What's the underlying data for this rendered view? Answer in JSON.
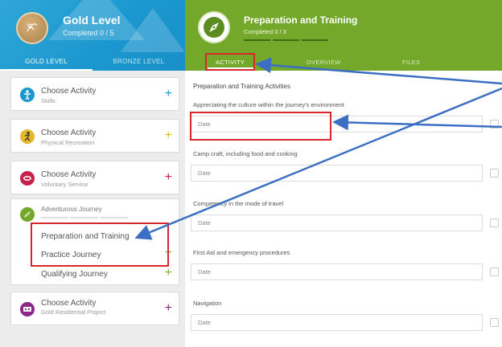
{
  "level_panel": {
    "title": "Gold Level",
    "completed": "Completed 0 / 5",
    "tabs": [
      "GOLD LEVEL",
      "BRONZE LEVEL"
    ]
  },
  "activities": [
    {
      "title": "Choose Activity",
      "subtitle": "Skills",
      "color": "#1b97cf",
      "icon": "person-icon"
    },
    {
      "title": "Choose Activity",
      "subtitle": "Physical Recreation",
      "color": "#e5b82a",
      "icon": "runner-icon"
    },
    {
      "title": "Choose Activity",
      "subtitle": "Voluntary Service",
      "color": "#c8214f",
      "icon": "lips-icon"
    },
    {
      "title": "Choose Activity",
      "subtitle": "Gold Residential Project",
      "color": "#8b2a89",
      "icon": "people-icon"
    }
  ],
  "adventurous": {
    "title": "Adventurous Journey",
    "color": "#74a82a",
    "items": [
      "Preparation and Training",
      "Practice Journey",
      "Qualifying Journey"
    ]
  },
  "detail": {
    "title": "Preparation and Training",
    "completed": "Completed 0 / 3",
    "tabs": [
      "ACTIVITY",
      "OVERVIEW",
      "FILES"
    ],
    "section_title": "Preparation and Training Activities",
    "date_placeholder": "Date",
    "fields": [
      "Appreciating the culture within the journey's environment",
      "Camp craft, including food and cooking",
      "Competency in the mode of travel",
      "First Aid and emergency procedures",
      "Navigation"
    ]
  },
  "annotation_color": "#d8262a",
  "arrow_color": "#3a6fc4"
}
